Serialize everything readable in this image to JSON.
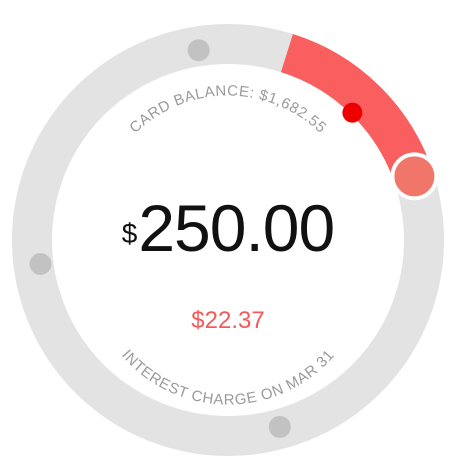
{
  "card_balance_label": "CARD BALANCE: $1,682.55",
  "payment": {
    "currency_symbol": "$",
    "amount": "250.00",
    "fraction_of_balance": 0.149
  },
  "interest": {
    "amount": "$22.37",
    "label": "INTEREST CHARGE ON MAR 31"
  },
  "colors": {
    "track": "#e3e3e3",
    "progress": "#fa5f5f",
    "marker": "#ef0000",
    "handle": "#f0766a",
    "interest_text": "#f25a5a",
    "tick": "#c2c2c2"
  }
}
